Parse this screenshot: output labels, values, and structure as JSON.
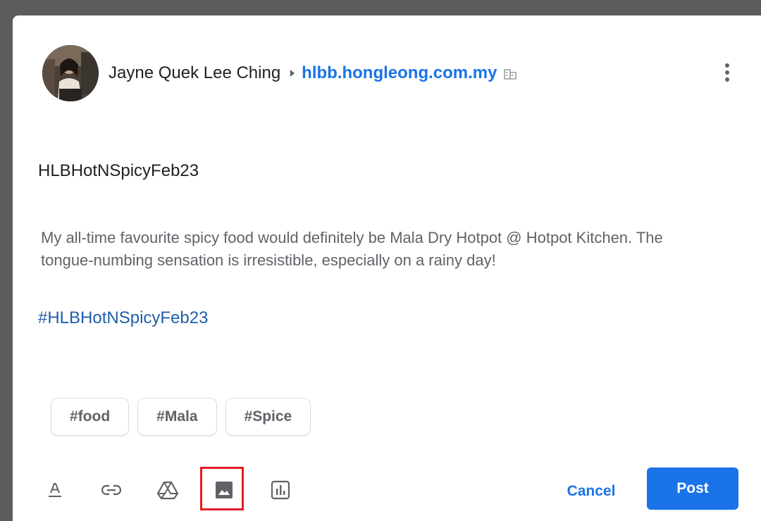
{
  "post": {
    "author": "Jayne Quek Lee Ching",
    "domain": "hlbb.hongleong.com.my",
    "title": "HLBHotNSpicyFeb23",
    "body": "My all-time favourite spicy food would definitely be Mala Dry Hotpot @ Hotpot Kitchen. The tongue-numbing sensation is irresistible, especially on a rainy day!",
    "hashtag": "#HLBHotNSpicyFeb23"
  },
  "chips": [
    "#food",
    "#Mala",
    "#Spice"
  ],
  "toolbar": {
    "tools": [
      "text-format-icon",
      "link-icon",
      "drive-icon",
      "image-icon",
      "poll-icon"
    ],
    "cancel_label": "Cancel",
    "post_label": "Post"
  },
  "colors": {
    "accent": "#1a73e8",
    "highlight": "#e51c23",
    "hashtag": "#1f5fa9"
  }
}
